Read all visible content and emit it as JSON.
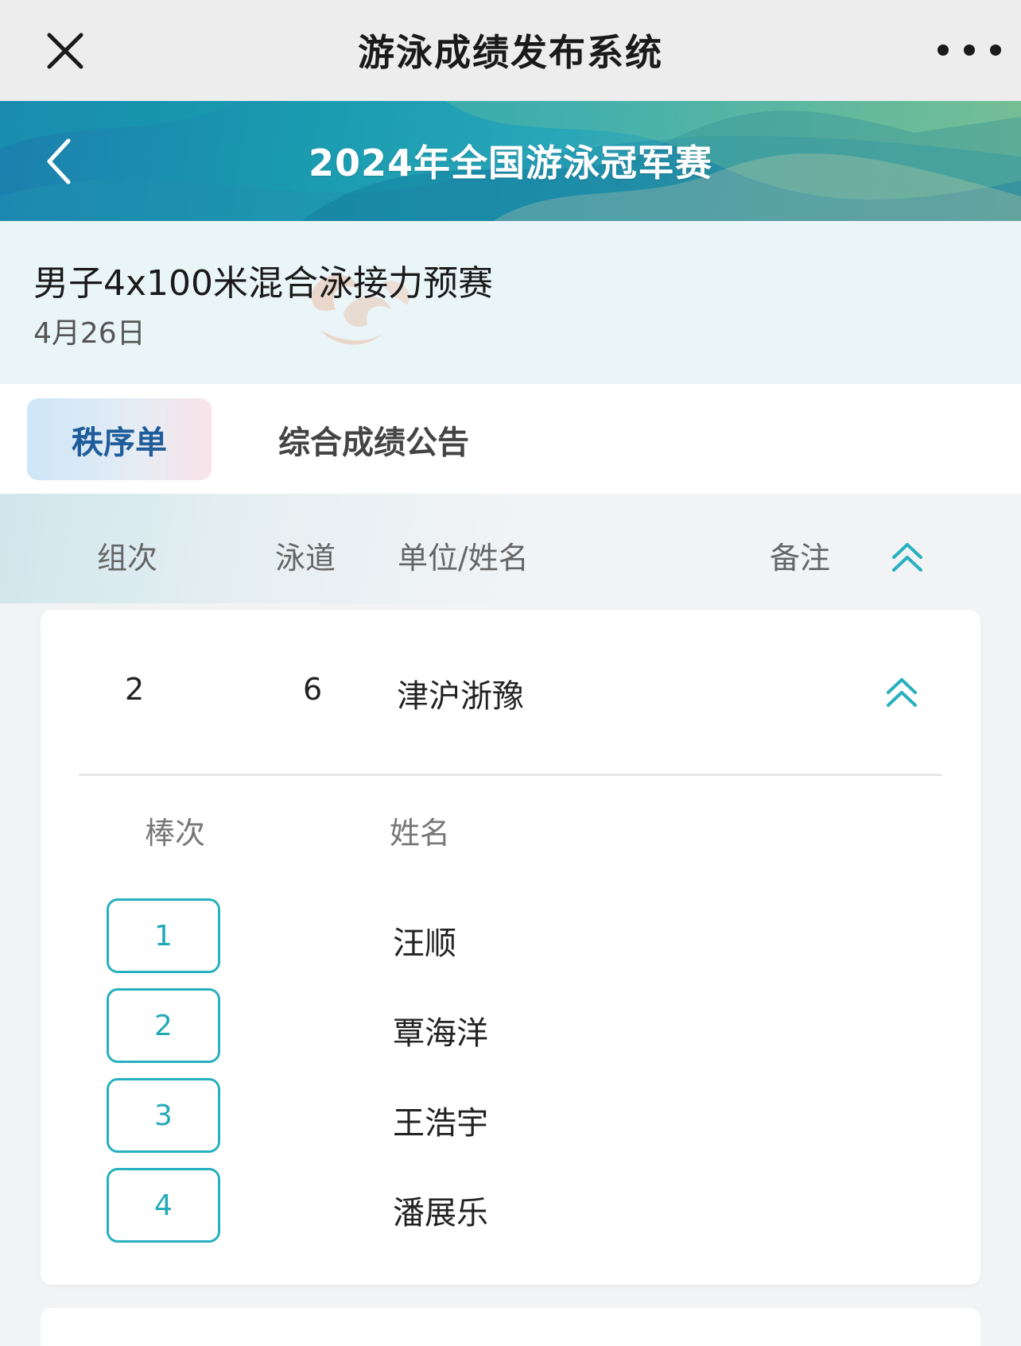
{
  "app_title": "游泳成绩发布系统",
  "competition_title": "2024年全国游泳冠军赛",
  "event": {
    "name": "男子4x100米混合泳接力预赛",
    "date": "4月26日"
  },
  "tabs": [
    {
      "label": "秩序单",
      "active": true
    },
    {
      "label": "综合成绩公告",
      "active": false
    }
  ],
  "table_header": {
    "group": "组次",
    "lane": "泳道",
    "unit_name": "单位/姓名",
    "remark": "备注"
  },
  "entry": {
    "group": "2",
    "lane": "6",
    "team": "津沪浙豫",
    "sub_header": {
      "leg": "棒次",
      "name": "姓名"
    },
    "legs": [
      {
        "leg": "1",
        "name": "汪顺"
      },
      {
        "leg": "2",
        "name": "覃海洋"
      },
      {
        "leg": "3",
        "name": "王浩宇"
      },
      {
        "leg": "4",
        "name": "潘展乐"
      }
    ]
  },
  "colors": {
    "accent": "#27b0bf",
    "active_tab_text": "#1f5d9a"
  },
  "icons": {
    "close": "close-icon",
    "more": "more-dots-icon",
    "back": "chevron-left-icon",
    "collapse": "double-chevron-up-icon"
  }
}
